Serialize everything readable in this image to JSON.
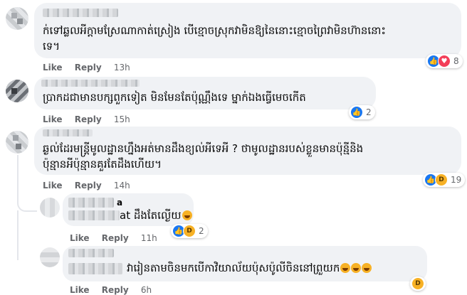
{
  "actions": {
    "like": "Like",
    "reply": "Reply"
  },
  "colors": {
    "bubble": "#f0f2f5",
    "muted": "#65676b",
    "like": "#1877f2",
    "love": "#f33e58",
    "haha": "#f7b125"
  },
  "comments": [
    {
      "lines": [
        "ក់ទៅឆ្លលអីក្តាមស្រែណាកាត់ស្រៀង បើខ្មោចស្រុកវាមិនឱ្យនៃនោះខ្មោចព្រៃវាមិនហ៊ាននោះ",
        "ទេ។"
      ],
      "time": "13h",
      "reactions": {
        "icons": [
          "like-icon",
          "love-icon"
        ],
        "count": "8"
      }
    },
    {
      "lines": [
        "ប្រាកដជាមានបក្សពួកទៀត មិនមែនតែប៉ុណ្ណឹងទេ ម្នាក់ឯងធ្វើមេចកើត"
      ],
      "time": "15h",
      "reactions": {
        "icons": [
          "like-icon"
        ],
        "count": "2"
      }
    },
    {
      "lines": [
        "ឆ្ងល់ដែរមន្ត្រីមូលដ្ឋានហ្នឹងអត់មានដឹងខ្យល់អីទេអី ? ថាមូលដ្ឋានរបស់ខ្លួនមានប៉ុន្មីនិង",
        "ប៉ុន្មានអីប៉ុន្មានគួរតែដឹងហើយ។"
      ],
      "time": "14h",
      "reactions": {
        "icons": [
          "like-icon",
          "haha-icon"
        ],
        "count": "19"
      }
    }
  ],
  "replies": [
    {
      "name_tail": "a",
      "text_prefix": "at",
      "text": "ដឹងតែល្ងើយ",
      "emoji": "laughing-emoji",
      "time": "11h",
      "reactions": {
        "icons": [
          "like-icon",
          "haha-icon"
        ],
        "count": "2"
      }
    },
    {
      "text": "វារៀនតាមចិនមកបើកាវិយាល័យប៉ុសប៉ូលីចិននៅព្រួយក",
      "emoji_count": 3,
      "time": "6h",
      "reactions": {
        "icons": [
          "haha-icon"
        ],
        "count": ""
      }
    }
  ]
}
